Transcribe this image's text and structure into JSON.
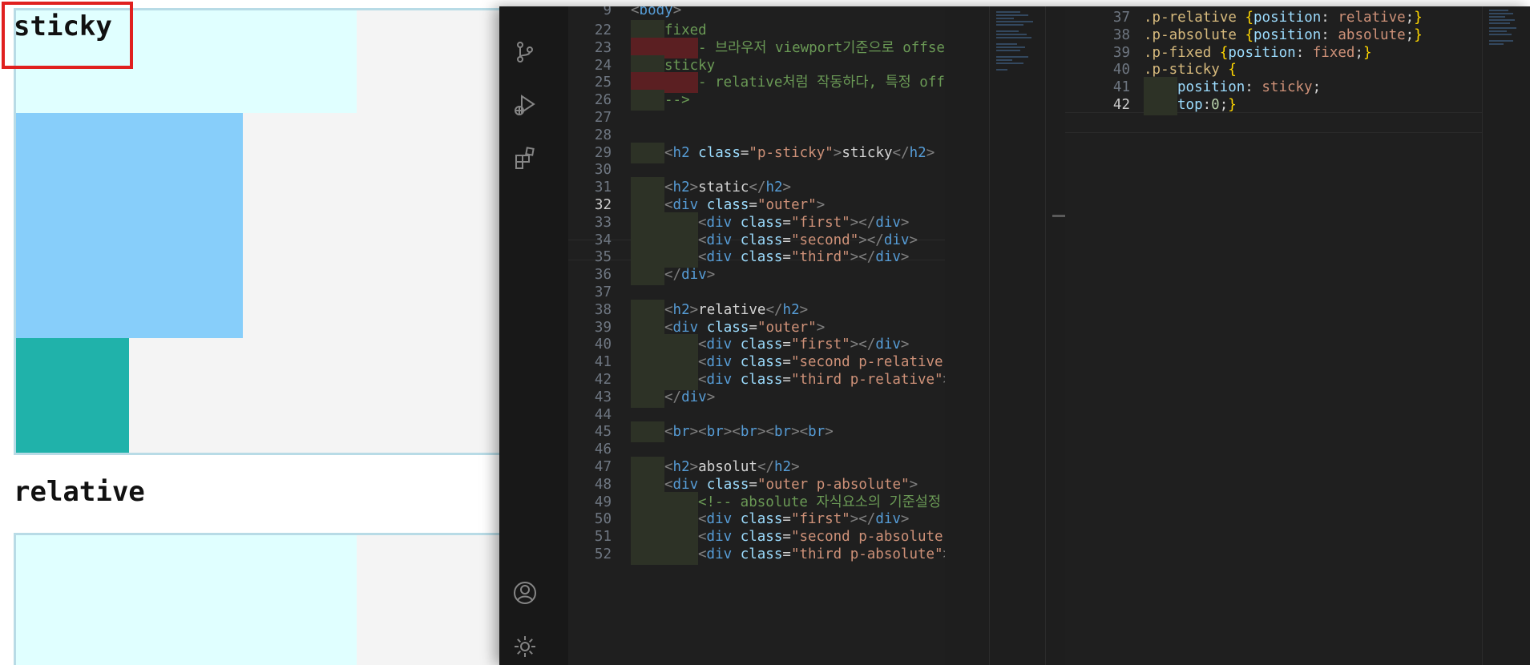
{
  "preview": {
    "sticky_heading": "sticky",
    "relative_heading": "relative",
    "colors": {
      "first": "#e0ffff",
      "second": "#87cefa",
      "third": "#20b2aa",
      "outer_bg": "#f4f4f4",
      "outer_border": "#b8dbe6"
    }
  },
  "activity_bar": {
    "top_icons": [
      "source-control-icon",
      "run-debug-icon",
      "extensions-icon"
    ],
    "bottom_icons": [
      "account-icon",
      "settings-gear-icon"
    ]
  },
  "html_editor": {
    "sticky_header_line": {
      "num": "9",
      "tokens": [
        [
          "tg",
          "<"
        ],
        [
          "tn",
          "body"
        ],
        [
          "tg",
          ">"
        ]
      ]
    },
    "current_line": "32",
    "lines": [
      {
        "num": "22",
        "indent": 1,
        "tokens": [
          [
            "cm",
            "fixed"
          ]
        ]
      },
      {
        "num": "23",
        "indent": 2,
        "tokens": [
          [
            "cm",
            "- 브라우저 viewport기준으로 offset적용"
          ]
        ]
      },
      {
        "num": "24",
        "indent": 1,
        "tokens": [
          [
            "cm",
            "sticky"
          ]
        ]
      },
      {
        "num": "25",
        "indent": 2,
        "tokens": [
          [
            "cm",
            "- relative처럼 작동하다, 특정 offset에"
          ]
        ]
      },
      {
        "num": "26",
        "indent": 1,
        "tokens": [
          [
            "cm",
            "-->"
          ]
        ]
      },
      {
        "num": "27",
        "indent": 0,
        "tokens": []
      },
      {
        "num": "28",
        "indent": 0,
        "tokens": []
      },
      {
        "num": "29",
        "indent": 1,
        "tokens": [
          [
            "tg",
            "<"
          ],
          [
            "tn",
            "h2"
          ],
          [
            "tx",
            " "
          ],
          [
            "at",
            "class"
          ],
          [
            "tx",
            "="
          ],
          [
            "st",
            "\"p-sticky\""
          ],
          [
            "tg",
            ">"
          ],
          [
            "tx",
            "sticky"
          ],
          [
            "tg",
            "</"
          ],
          [
            "tn",
            "h2"
          ],
          [
            "tg",
            ">"
          ]
        ]
      },
      {
        "num": "30",
        "indent": 0,
        "tokens": []
      },
      {
        "num": "31",
        "indent": 1,
        "tokens": [
          [
            "tg",
            "<"
          ],
          [
            "tn",
            "h2"
          ],
          [
            "tg",
            ">"
          ],
          [
            "tx",
            "static"
          ],
          [
            "tg",
            "</"
          ],
          [
            "tn",
            "h2"
          ],
          [
            "tg",
            ">"
          ]
        ]
      },
      {
        "num": "32",
        "indent": 1,
        "tokens": [
          [
            "tg",
            "<"
          ],
          [
            "tn",
            "div"
          ],
          [
            "tx",
            " "
          ],
          [
            "at",
            "class"
          ],
          [
            "tx",
            "="
          ],
          [
            "st",
            "\"outer\""
          ],
          [
            "tg",
            ">"
          ]
        ]
      },
      {
        "num": "33",
        "indent": 2,
        "tokens": [
          [
            "tg",
            "<"
          ],
          [
            "tn",
            "div"
          ],
          [
            "tx",
            " "
          ],
          [
            "at",
            "class"
          ],
          [
            "tx",
            "="
          ],
          [
            "st",
            "\"first\""
          ],
          [
            "tg",
            "></"
          ],
          [
            "tn",
            "div"
          ],
          [
            "tg",
            ">"
          ]
        ]
      },
      {
        "num": "34",
        "indent": 2,
        "tokens": [
          [
            "tg",
            "<"
          ],
          [
            "tn",
            "div"
          ],
          [
            "tx",
            " "
          ],
          [
            "at",
            "class"
          ],
          [
            "tx",
            "="
          ],
          [
            "st",
            "\"second\""
          ],
          [
            "tg",
            "></"
          ],
          [
            "tn",
            "div"
          ],
          [
            "tg",
            ">"
          ]
        ]
      },
      {
        "num": "35",
        "indent": 2,
        "tokens": [
          [
            "tg",
            "<"
          ],
          [
            "tn",
            "div"
          ],
          [
            "tx",
            " "
          ],
          [
            "at",
            "class"
          ],
          [
            "tx",
            "="
          ],
          [
            "st",
            "\"third\""
          ],
          [
            "tg",
            "></"
          ],
          [
            "tn",
            "div"
          ],
          [
            "tg",
            ">"
          ]
        ]
      },
      {
        "num": "36",
        "indent": 1,
        "tokens": [
          [
            "tg",
            "</"
          ],
          [
            "tn",
            "div"
          ],
          [
            "tg",
            ">"
          ]
        ]
      },
      {
        "num": "37",
        "indent": 0,
        "tokens": []
      },
      {
        "num": "38",
        "indent": 1,
        "tokens": [
          [
            "tg",
            "<"
          ],
          [
            "tn",
            "h2"
          ],
          [
            "tg",
            ">"
          ],
          [
            "tx",
            "relative"
          ],
          [
            "tg",
            "</"
          ],
          [
            "tn",
            "h2"
          ],
          [
            "tg",
            ">"
          ]
        ]
      },
      {
        "num": "39",
        "indent": 1,
        "tokens": [
          [
            "tg",
            "<"
          ],
          [
            "tn",
            "div"
          ],
          [
            "tx",
            " "
          ],
          [
            "at",
            "class"
          ],
          [
            "tx",
            "="
          ],
          [
            "st",
            "\"outer\""
          ],
          [
            "tg",
            ">"
          ]
        ]
      },
      {
        "num": "40",
        "indent": 2,
        "tokens": [
          [
            "tg",
            "<"
          ],
          [
            "tn",
            "div"
          ],
          [
            "tx",
            " "
          ],
          [
            "at",
            "class"
          ],
          [
            "tx",
            "="
          ],
          [
            "st",
            "\"first\""
          ],
          [
            "tg",
            "></"
          ],
          [
            "tn",
            "div"
          ],
          [
            "tg",
            ">"
          ]
        ]
      },
      {
        "num": "41",
        "indent": 2,
        "tokens": [
          [
            "tg",
            "<"
          ],
          [
            "tn",
            "div"
          ],
          [
            "tx",
            " "
          ],
          [
            "at",
            "class"
          ],
          [
            "tx",
            "="
          ],
          [
            "st",
            "\"second p-relative\""
          ],
          [
            "tg",
            "></"
          ],
          [
            "tn",
            "d"
          ]
        ]
      },
      {
        "num": "42",
        "indent": 2,
        "tokens": [
          [
            "tg",
            "<"
          ],
          [
            "tn",
            "div"
          ],
          [
            "tx",
            " "
          ],
          [
            "at",
            "class"
          ],
          [
            "tx",
            "="
          ],
          [
            "st",
            "\"third p-relative\""
          ],
          [
            "tg",
            "></"
          ],
          [
            "tn",
            "di"
          ]
        ]
      },
      {
        "num": "43",
        "indent": 1,
        "tokens": [
          [
            "tg",
            "</"
          ],
          [
            "tn",
            "div"
          ],
          [
            "tg",
            ">"
          ]
        ]
      },
      {
        "num": "44",
        "indent": 0,
        "tokens": []
      },
      {
        "num": "45",
        "indent": 1,
        "tokens": [
          [
            "tg",
            "<"
          ],
          [
            "tn",
            "br"
          ],
          [
            "tg",
            "><"
          ],
          [
            "tn",
            "br"
          ],
          [
            "tg",
            "><"
          ],
          [
            "tn",
            "br"
          ],
          [
            "tg",
            "><"
          ],
          [
            "tn",
            "br"
          ],
          [
            "tg",
            "><"
          ],
          [
            "tn",
            "br"
          ],
          [
            "tg",
            ">"
          ]
        ]
      },
      {
        "num": "46",
        "indent": 0,
        "tokens": []
      },
      {
        "num": "47",
        "indent": 1,
        "tokens": [
          [
            "tg",
            "<"
          ],
          [
            "tn",
            "h2"
          ],
          [
            "tg",
            ">"
          ],
          [
            "tx",
            "absolut"
          ],
          [
            "tg",
            "</"
          ],
          [
            "tn",
            "h2"
          ],
          [
            "tg",
            ">"
          ]
        ]
      },
      {
        "num": "48",
        "indent": 1,
        "tokens": [
          [
            "tg",
            "<"
          ],
          [
            "tn",
            "div"
          ],
          [
            "tx",
            " "
          ],
          [
            "at",
            "class"
          ],
          [
            "tx",
            "="
          ],
          [
            "st",
            "\"outer p-absolute\""
          ],
          [
            "tg",
            ">"
          ]
        ]
      },
      {
        "num": "49",
        "indent": 2,
        "tokens": [
          [
            "cm",
            "<!-- absolute 자식요소의 기준설정 --"
          ]
        ]
      },
      {
        "num": "50",
        "indent": 2,
        "tokens": [
          [
            "tg",
            "<"
          ],
          [
            "tn",
            "div"
          ],
          [
            "tx",
            " "
          ],
          [
            "at",
            "class"
          ],
          [
            "tx",
            "="
          ],
          [
            "st",
            "\"first\""
          ],
          [
            "tg",
            "></"
          ],
          [
            "tn",
            "div"
          ],
          [
            "tg",
            ">"
          ]
        ]
      },
      {
        "num": "51",
        "indent": 2,
        "tokens": [
          [
            "tg",
            "<"
          ],
          [
            "tn",
            "div"
          ],
          [
            "tx",
            " "
          ],
          [
            "at",
            "class"
          ],
          [
            "tx",
            "="
          ],
          [
            "st",
            "\"second p-absolute\""
          ],
          [
            "tg",
            "></"
          ],
          [
            "tn",
            "d"
          ]
        ]
      },
      {
        "num": "52",
        "indent": 2,
        "tokens": [
          [
            "tg",
            "<"
          ],
          [
            "tn",
            "div"
          ],
          [
            "tx",
            " "
          ],
          [
            "at",
            "class"
          ],
          [
            "tx",
            "="
          ],
          [
            "st",
            "\"third p-absolute\""
          ],
          [
            "tg",
            "></"
          ],
          [
            "tn",
            "di"
          ]
        ]
      }
    ]
  },
  "css_editor": {
    "current_line": "42",
    "lines": [
      {
        "num": "37",
        "indent": 0,
        "tokens": [
          [
            "sel",
            ".p-relative"
          ],
          [
            "pu",
            " "
          ],
          [
            "br",
            "{"
          ],
          [
            "pr",
            "position"
          ],
          [
            "pu",
            ": "
          ],
          [
            "vl",
            "relative"
          ],
          [
            "pu",
            ";"
          ],
          [
            "br",
            "}"
          ]
        ]
      },
      {
        "num": "38",
        "indent": 0,
        "tokens": [
          [
            "sel",
            ".p-absolute"
          ],
          [
            "pu",
            " "
          ],
          [
            "br",
            "{"
          ],
          [
            "pr",
            "position"
          ],
          [
            "pu",
            ": "
          ],
          [
            "vl",
            "absolute"
          ],
          [
            "pu",
            ";"
          ],
          [
            "br",
            "}"
          ]
        ]
      },
      {
        "num": "39",
        "indent": 0,
        "tokens": [
          [
            "sel",
            ".p-fixed"
          ],
          [
            "pu",
            " "
          ],
          [
            "br",
            "{"
          ],
          [
            "pr",
            "position"
          ],
          [
            "pu",
            ": "
          ],
          [
            "vl",
            "fixed"
          ],
          [
            "pu",
            ";"
          ],
          [
            "br",
            "}"
          ]
        ]
      },
      {
        "num": "40",
        "indent": 0,
        "tokens": [
          [
            "sel",
            ".p-sticky"
          ],
          [
            "pu",
            " "
          ],
          [
            "br",
            "{"
          ]
        ]
      },
      {
        "num": "41",
        "indent": 1,
        "tokens": [
          [
            "pr",
            "position"
          ],
          [
            "pu",
            ": "
          ],
          [
            "vl",
            "sticky"
          ],
          [
            "pu",
            ";"
          ]
        ]
      },
      {
        "num": "42",
        "indent": 1,
        "tokens": [
          [
            "pr",
            "top"
          ],
          [
            "pu",
            ":"
          ],
          [
            "nu",
            "0"
          ],
          [
            "pu",
            ";"
          ],
          [
            "br",
            "}"
          ]
        ]
      }
    ]
  }
}
